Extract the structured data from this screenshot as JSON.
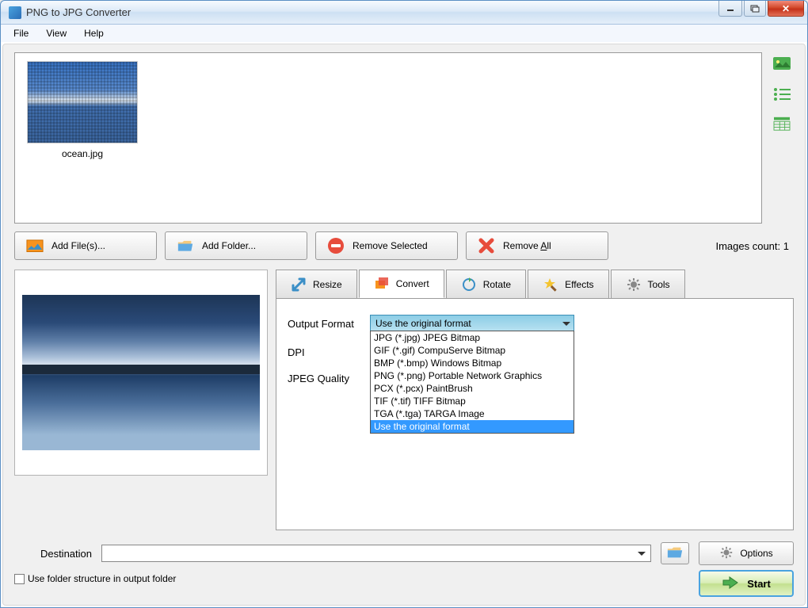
{
  "window": {
    "title": "PNG to JPG Converter"
  },
  "menu": {
    "file": "File",
    "view": "View",
    "help": "Help"
  },
  "gallery": {
    "items": [
      {
        "label": "ocean.jpg"
      }
    ]
  },
  "toolbar": {
    "add_file": "Add File(s)...",
    "add_folder": "Add Folder...",
    "remove_selected": "Remove Selected",
    "remove_all_prefix": "Remove ",
    "remove_all_key": "A",
    "remove_all_suffix": "ll",
    "images_count_prefix": "Images count: ",
    "images_count": "1"
  },
  "tabs": {
    "resize": "Resize",
    "convert": "Convert",
    "rotate": "Rotate",
    "effects": "Effects",
    "tools": "Tools"
  },
  "convert": {
    "output_format_label": "Output Format",
    "dpi_label": "DPI",
    "jpeg_quality_label": "JPEG Quality",
    "combo_value": "Use the original format",
    "options": [
      "JPG (*.jpg) JPEG Bitmap",
      "GIF (*.gif) CompuServe Bitmap",
      "BMP (*.bmp) Windows Bitmap",
      "PNG (*.png) Portable Network Graphics",
      "PCX (*.pcx) PaintBrush",
      "TIF (*.tif) TIFF Bitmap",
      "TGA (*.tga) TARGA Image",
      "Use the original format"
    ],
    "selected_index": 7
  },
  "destination": {
    "label": "Destination",
    "value": "",
    "options_label": "Options",
    "use_folder_structure": "Use folder structure in output folder"
  },
  "start": {
    "label": "Start"
  }
}
